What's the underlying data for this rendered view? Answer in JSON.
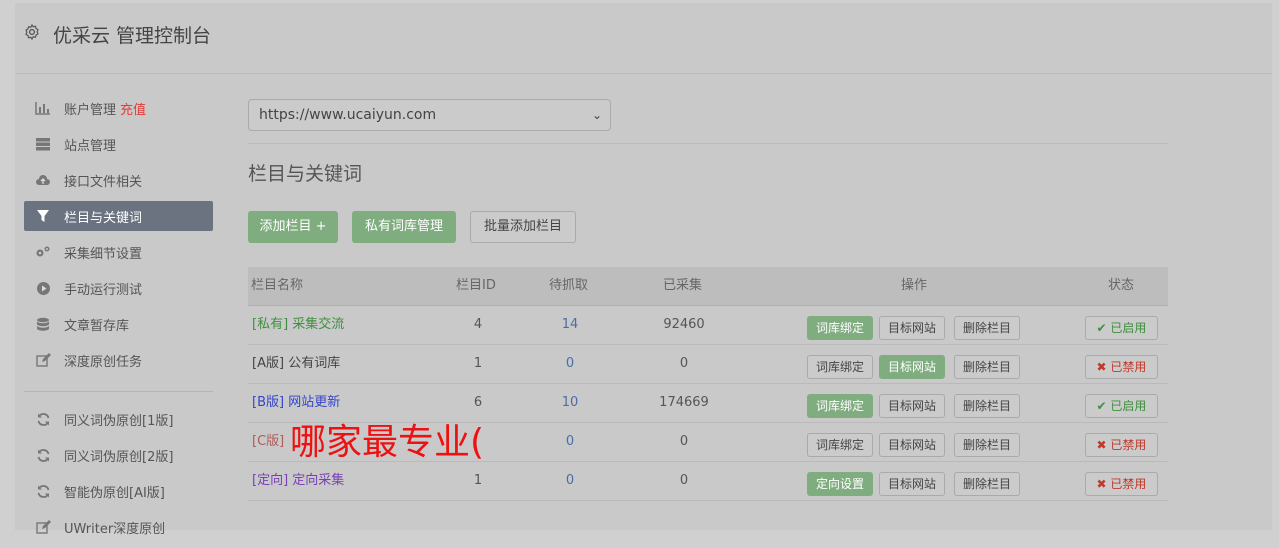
{
  "app": {
    "title": "优采云 管理控制台"
  },
  "sidebar": {
    "items": [
      {
        "label": "账户管理",
        "badge": "充值",
        "icon": "bar-chart-icon"
      },
      {
        "label": "站点管理",
        "icon": "server-icon"
      },
      {
        "label": "接口文件相关",
        "icon": "cloud-upload-icon"
      },
      {
        "label": "栏目与关键词",
        "icon": "filter-icon",
        "active": true
      },
      {
        "label": "采集细节设置",
        "icon": "cogs-icon"
      },
      {
        "label": "手动运行测试",
        "icon": "play-circle-icon"
      },
      {
        "label": "文章暂存库",
        "icon": "database-icon"
      },
      {
        "label": "深度原创任务",
        "icon": "edit-icon"
      }
    ],
    "items2": [
      {
        "label": "同义词伪原创[1版]",
        "icon": "refresh-icon"
      },
      {
        "label": "同义词伪原创[2版]",
        "icon": "refresh-icon"
      },
      {
        "label": "智能伪原创[AI版]",
        "icon": "refresh-icon"
      },
      {
        "label": "UWriter深度原创",
        "icon": "edit-icon"
      }
    ]
  },
  "site_select": {
    "value": "https://www.ucaiyun.com"
  },
  "section": {
    "title": "栏目与关键词"
  },
  "actions": {
    "add_column": "添加栏目 +",
    "private_lexicon": "私有词库管理",
    "batch_add": "批量添加栏目"
  },
  "table": {
    "headers": [
      "栏目名称",
      "栏目ID",
      "待抓取",
      "已采集",
      "操作",
      "状态"
    ],
    "rows": [
      {
        "tag": "[私有]",
        "name": "采集交流",
        "id": "4",
        "pending": "14",
        "collected": "92460",
        "op1": "词库绑定",
        "op1_green": true,
        "op2": "目标网站",
        "op2_green": false,
        "op3": "删除栏目",
        "status": "已启用",
        "on": true,
        "color": "c-green"
      },
      {
        "tag": "[A版]",
        "name": "公有词库",
        "id": "1",
        "pending": "0",
        "collected": "0",
        "op1": "词库绑定",
        "op1_green": false,
        "op2": "目标网站",
        "op2_green": true,
        "op3": "删除栏目",
        "status": "已禁用",
        "on": false,
        "color": "c-dark"
      },
      {
        "tag": "[B版]",
        "name": "网站更新",
        "id": "6",
        "pending": "10",
        "collected": "174669",
        "op1": "词库绑定",
        "op1_green": true,
        "op2": "目标网站",
        "op2_green": false,
        "op3": "删除栏目",
        "status": "已启用",
        "on": true,
        "color": "c-blue"
      },
      {
        "tag": "[C版]",
        "name": "",
        "id": "",
        "pending": "0",
        "collected": "0",
        "op1": "词库绑定",
        "op1_green": false,
        "op2": "目标网站",
        "op2_green": false,
        "op3": "删除栏目",
        "status": "已禁用",
        "on": false,
        "color": "c-red"
      },
      {
        "tag": "[定向]",
        "name": "定向采集",
        "id": "1",
        "pending": "0",
        "collected": "0",
        "op1": "定向设置",
        "op1_green": true,
        "op2": "目标网站",
        "op2_green": false,
        "op3": "删除栏目",
        "status": "已禁用",
        "on": false,
        "color": "c-purple"
      }
    ]
  },
  "overlay": {
    "text": "哪家最专业("
  }
}
